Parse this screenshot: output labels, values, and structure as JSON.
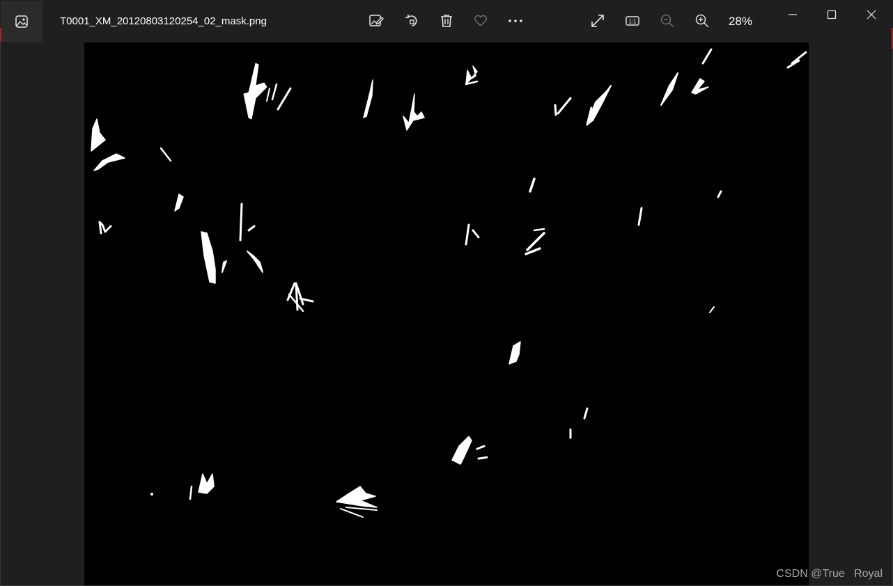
{
  "window": {
    "file_name": "T0001_XM_20120803120254_02_mask.png",
    "zoom_level": "28%"
  },
  "toolbar": [
    {
      "icon": "edit-image-icon"
    },
    {
      "icon": "rotate-icon"
    },
    {
      "icon": "delete-icon"
    },
    {
      "icon": "favorite-heart-icon"
    },
    {
      "icon": "more-options-icon"
    },
    {
      "icon": "fullscreen-icon"
    },
    {
      "icon": "actual-size-icon",
      "glyph": "1:1"
    },
    {
      "icon": "zoom-out-icon"
    },
    {
      "icon": "zoom-in-icon"
    }
  ],
  "window_controls": [
    {
      "icon": "minimize-icon"
    },
    {
      "icon": "maximize-icon"
    },
    {
      "icon": "close-icon"
    }
  ],
  "image": {
    "description_visible": "binary mask: white blade-like shapes on black background",
    "foreground_color": "#ffffff",
    "background_color": "#000000"
  },
  "watermark": {
    "text": "CSDN @True   Royal"
  },
  "colors": {
    "chrome_background": "#1f1f1f",
    "icon_color": "#e6e6e6",
    "icon_disabled": "#6f6f6f"
  }
}
